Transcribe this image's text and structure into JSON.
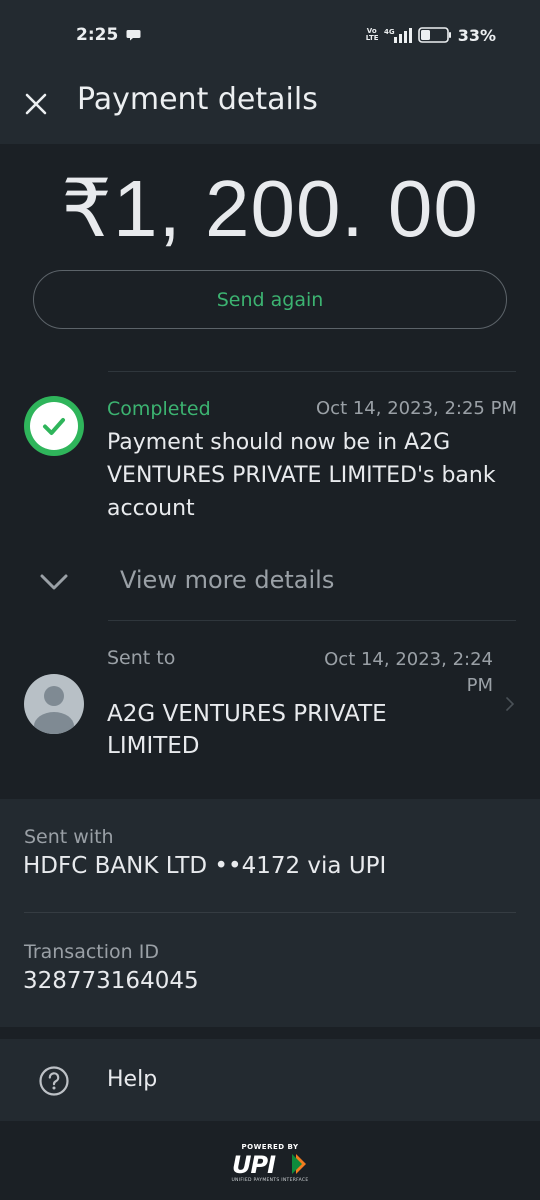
{
  "status_bar": {
    "time": "2:25",
    "network_small": "Vo LTE",
    "network_type": "4G",
    "battery": "33%"
  },
  "header": {
    "title": "Payment details"
  },
  "amount": "₹1, 200. 00",
  "send_again_label": "Send again",
  "status": {
    "label": "Completed",
    "timestamp": "Oct 14,  2023,  2:25 PM",
    "description": "Payment should now be in A2G VENTURES PRIVATE LIMITED's bank account"
  },
  "view_more_label": "View more details",
  "sent_to": {
    "label": "Sent to",
    "timestamp": "Oct 14,  2023,  2:24 PM",
    "recipient": "A2G VENTURES PRIVATE LIMITED"
  },
  "sent_with": {
    "label": "Sent with",
    "value": "HDFC BANK LTD ••4172 via UPI"
  },
  "transaction": {
    "label": "Transaction ID",
    "value": "328773164045"
  },
  "help_label": "Help",
  "footer": {
    "powered_by": "POWERED BY",
    "logo_text": "UPI",
    "sub_text": "UNIFIED PAYMENTS INTERFACE"
  },
  "colors": {
    "success": "#3cb371",
    "background": "#1b2025",
    "card": "#232a30"
  },
  "icons": [
    "close-icon",
    "check-circle-icon",
    "chevron-down-icon",
    "avatar-person-icon",
    "chevron-right-icon",
    "help-circle-icon",
    "upi-logo"
  ]
}
